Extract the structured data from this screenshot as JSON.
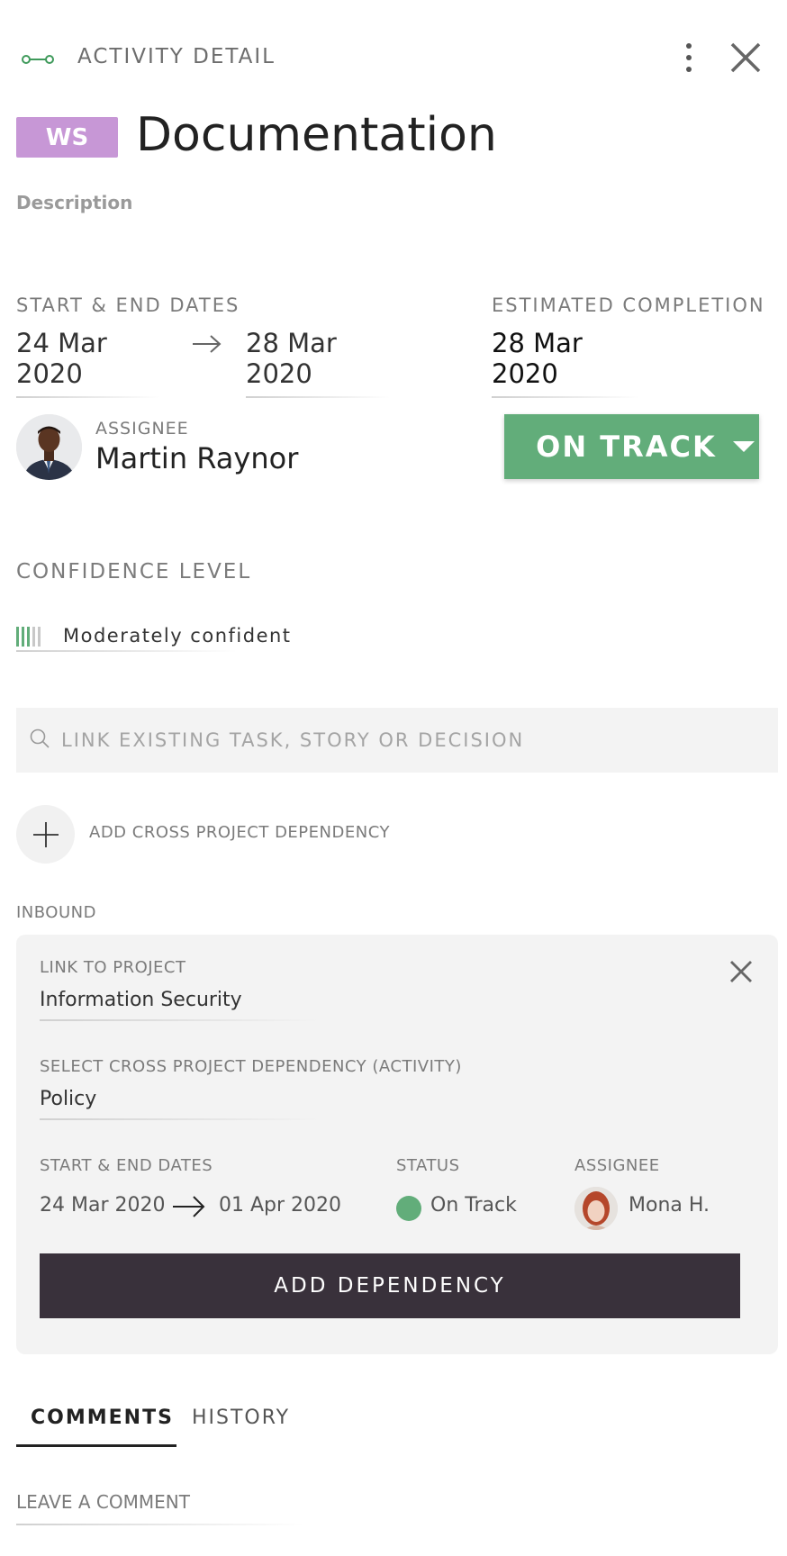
{
  "header": {
    "icon": "link-icon",
    "title": "ACTIVITY DETAIL",
    "menu_icon": "kebab-menu-icon",
    "close_icon": "close-icon"
  },
  "activity": {
    "badge": "WS",
    "badge_color": "#c797d6",
    "title": "Documentation",
    "description_label": "Description"
  },
  "dates": {
    "label": "START & END DATES",
    "start": "24 Mar 2020",
    "end": "28 Mar 2020",
    "estimated_label": "ESTIMATED COMPLETION",
    "estimated": "28 Mar 2020"
  },
  "assignee": {
    "label": "ASSIGNEE",
    "name": "Martin Raynor"
  },
  "status": {
    "label": "ON TRACK",
    "color": "#62ad7a"
  },
  "confidence": {
    "label": "CONFIDENCE LEVEL",
    "value": "Moderately confident",
    "level": 3,
    "max": 5
  },
  "search": {
    "placeholder": "LINK EXISTING TASK, STORY OR DECISION"
  },
  "cross_project": {
    "add_label": "ADD CROSS PROJECT DEPENDENCY"
  },
  "inbound": {
    "label": "INBOUND",
    "link_project_label": "LINK TO PROJECT",
    "link_project_value": "Information Security",
    "select_dep_label": "SELECT CROSS PROJECT DEPENDENCY (ACTIVITY)",
    "select_dep_value": "Policy",
    "dates_label": "START & END DATES",
    "start": "24 Mar 2020",
    "end": "01 Apr 2020",
    "status_label": "STATUS",
    "status_value": "On Track",
    "assignee_label": "ASSIGNEE",
    "assignee_value": "Mona H.",
    "add_button": "ADD DEPENDENCY"
  },
  "tabs": [
    {
      "label": "COMMENTS",
      "active": true
    },
    {
      "label": "HISTORY",
      "active": false
    }
  ],
  "comment": {
    "placeholder": "LEAVE A COMMENT"
  }
}
